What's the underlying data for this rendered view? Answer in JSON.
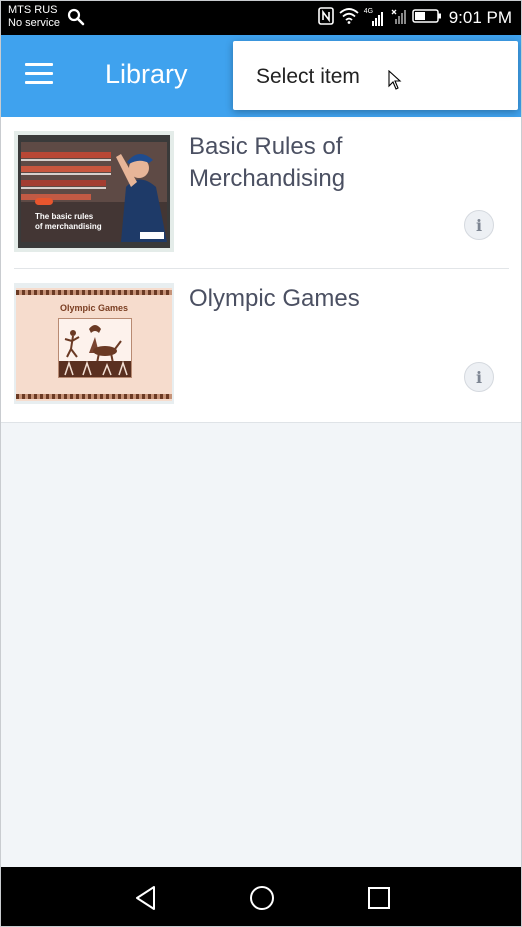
{
  "status_bar": {
    "carrier": "MTS RUS",
    "service": "No service",
    "network": "4G",
    "time": "9:01 PM"
  },
  "app_bar": {
    "title": "Library"
  },
  "popup_menu": {
    "item_label": "Select item"
  },
  "library": {
    "items": [
      {
        "title": "Basic Rules of Merchandising",
        "thumb_caption_line1": "The basic rules",
        "thumb_caption_line2": "of merchandising"
      },
      {
        "title": "Olympic Games",
        "thumb_title": "Olympic Games"
      }
    ]
  },
  "colors": {
    "app_bar": "#3fa2ee",
    "background": "#f2f5f8",
    "title_text": "#4b5062"
  }
}
